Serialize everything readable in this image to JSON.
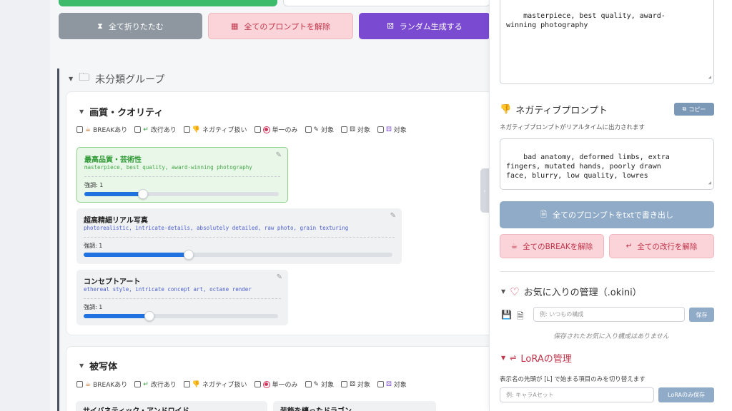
{
  "toolbar": {
    "collapse_all": "全て折りたたむ",
    "clear_all_prompts": "全てのプロンプトを解除",
    "random_generate": "ランダム生成する"
  },
  "group": {
    "name": "未分類グループ"
  },
  "option_labels": {
    "break": "BREAKあり",
    "newline": "改行あり",
    "negative": "ネガティブ扱い",
    "single": "単一のみ",
    "target1": "対象",
    "target2": "対象"
  },
  "categories": [
    {
      "title": "画質・クオリティ",
      "items": [
        {
          "name": "最高品質・芸術性",
          "prompt": "masterpiece, best quality, award-winning photography",
          "weight_label": "強調: 1",
          "weight": 0.3,
          "selected": true
        },
        {
          "name": "超高精細リアル写真",
          "prompt": "photorealistic, intricate-details, absolutely detailed, raw photo, grain texturing",
          "weight_label": "強調: 1",
          "weight": 0.34,
          "selected": false
        },
        {
          "name": "コンセプトアート",
          "prompt": "ethereal style, intricate concept art, octane render",
          "weight_label": "強調: 1",
          "weight": 0.34,
          "selected": false
        }
      ]
    },
    {
      "title": "被写体",
      "items": [
        {
          "name": "サイバネティック・アンドロイド"
        },
        {
          "name": "装飾を纏ったドラゴン"
        }
      ]
    }
  ],
  "panel": {
    "positive_text": "masterpiece, best quality, award-\nwinning photography",
    "negative_title": "ネガティブプロンプト",
    "copy_label": "コピー",
    "negative_desc": "ネガティブプロンプトがリアルタイムに出力されます",
    "negative_text": "bad anatomy, deformed limbs, extra\nfingers, mutated hands, poorly drawn\nface, blurry, low quality, lowres",
    "export_label": "全てのプロンプトをtxtで書き出し",
    "clear_break_label": "全てのBREAKを解除",
    "clear_newline_label": "全ての改行を解除",
    "favorites_title": "お気に入りの管理（.okini）",
    "favorites_placeholder": "例: いつもの構成",
    "favorites_save": "保存",
    "favorites_empty": "保存されたお気に入り構成はありません",
    "lora_title": "LoRAの管理",
    "lora_desc": "表示名の先頭が [L] で始まる項目のみを切り替えます",
    "lora_placeholder": "例: キャラAセット",
    "lora_save": "LoRAのみ保存"
  },
  "colors": {
    "accent_purple": "#7a4bd1",
    "selected_green": "#2e9a34",
    "danger_pink": "#c0334a",
    "slider_blue": "#1f72e0"
  }
}
